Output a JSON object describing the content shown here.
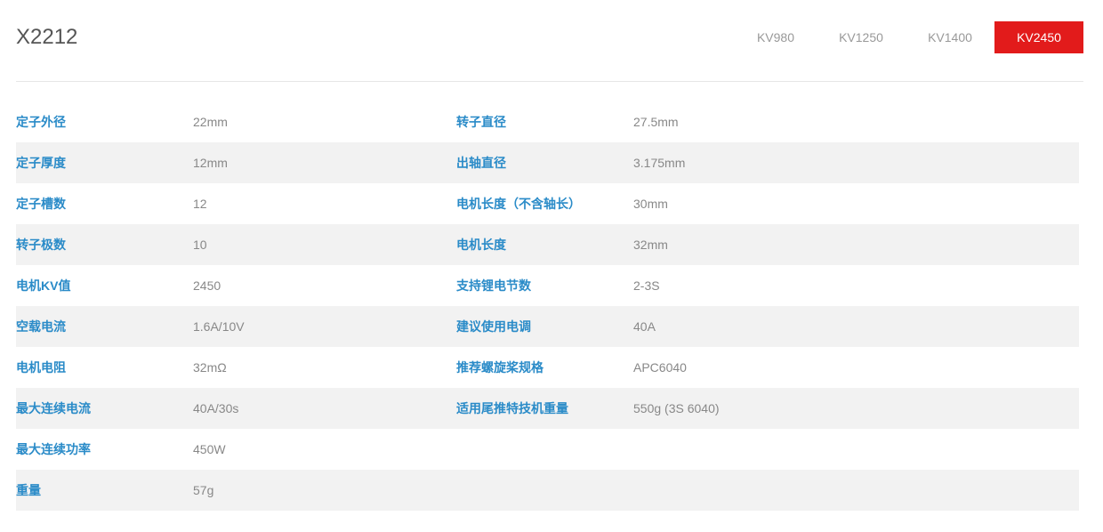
{
  "header": {
    "title": "X2212",
    "tabs": [
      {
        "label": "KV980",
        "active": false
      },
      {
        "label": "KV1250",
        "active": false
      },
      {
        "label": "KV1400",
        "active": false
      },
      {
        "label": "KV2450",
        "active": true
      }
    ]
  },
  "colors": {
    "accent": "#e21b1b",
    "label": "#2a8bc8",
    "value": "#888888",
    "stripe": "#f2f2f2"
  },
  "specs": {
    "rows": [
      {
        "label1": "定子外径",
        "value1": "22mm",
        "label2": "转子直径",
        "value2": "27.5mm"
      },
      {
        "label1": "定子厚度",
        "value1": "12mm",
        "label2": "出轴直径",
        "value2": "3.175mm"
      },
      {
        "label1": "定子槽数",
        "value1": "12",
        "label2": "电机长度（不含轴长）",
        "value2": "30mm"
      },
      {
        "label1": "转子极数",
        "value1": "10",
        "label2": "电机长度",
        "value2": "32mm"
      },
      {
        "label1": "电机KV值",
        "value1": "2450",
        "label2": "支持锂电节数",
        "value2": "2-3S"
      },
      {
        "label1": "空载电流",
        "value1": "1.6A/10V",
        "label2": "建议使用电调",
        "value2": "40A"
      },
      {
        "label1": "电机电阻",
        "value1": "32mΩ",
        "label2": "推荐螺旋桨规格",
        "value2": "APC6040"
      },
      {
        "label1": "最大连续电流",
        "value1": "40A/30s",
        "label2": "适用尾推特技机重量",
        "value2": "550g (3S 6040)"
      },
      {
        "label1": "最大连续功率",
        "value1": "450W",
        "label2": "",
        "value2": ""
      },
      {
        "label1": "重量",
        "value1": "57g",
        "label2": "",
        "value2": ""
      }
    ]
  }
}
